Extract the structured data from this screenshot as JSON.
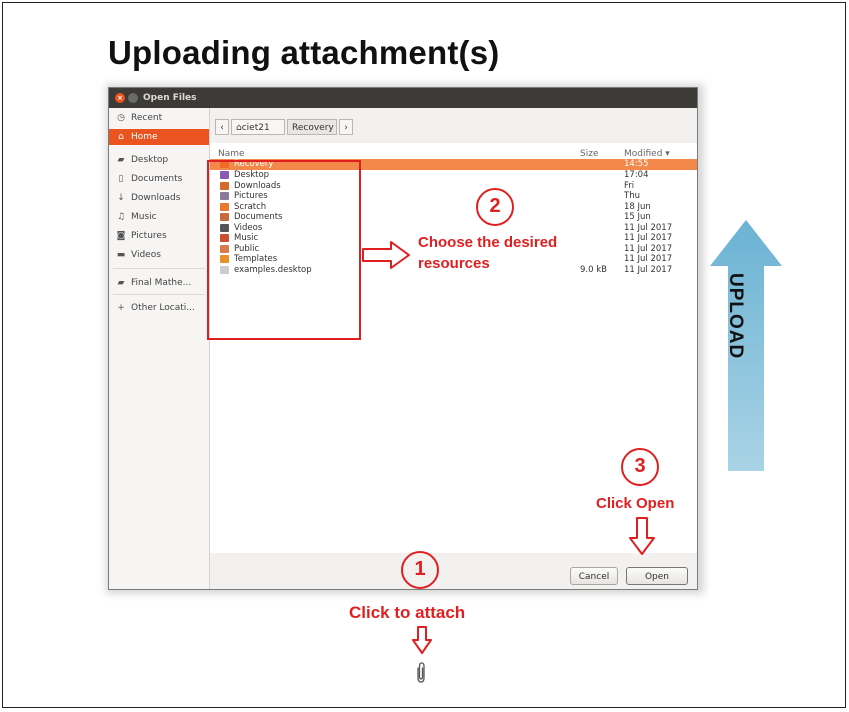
{
  "slide": {
    "title": "Uploading attachment(s)"
  },
  "dialog": {
    "window_title": "Open Files",
    "sidebar": [
      {
        "label": "Recent",
        "icon": "recent-icon"
      },
      {
        "label": "Home",
        "icon": "home-icon",
        "active": true
      },
      {
        "label": "Desktop",
        "icon": "desktop-folder-icon"
      },
      {
        "label": "Documents",
        "icon": "documents-icon"
      },
      {
        "label": "Downloads",
        "icon": "downloads-icon"
      },
      {
        "label": "Music",
        "icon": "music-icon"
      },
      {
        "label": "Pictures",
        "icon": "pictures-icon"
      },
      {
        "label": "Videos",
        "icon": "videos-icon"
      },
      {
        "label": "Final Mathe...",
        "icon": "drive-icon"
      },
      {
        "label": "Other Locati...",
        "icon": "plus-icon"
      }
    ],
    "breadcrumb": {
      "user": "ciet21",
      "current": "Recovery"
    },
    "columns": {
      "name": "Name",
      "size": "Size",
      "modified": "Modified"
    },
    "files": [
      {
        "name": "Recovery",
        "size": "",
        "modified": "14:55",
        "color": "#f06a2a"
      },
      {
        "name": "Desktop",
        "size": "",
        "modified": "17:04",
        "color": "#8a5ab0"
      },
      {
        "name": "Downloads",
        "size": "",
        "modified": "Fri",
        "color": "#d46a2a"
      },
      {
        "name": "Pictures",
        "size": "",
        "modified": "Thu",
        "color": "#8a7a9a"
      },
      {
        "name": "Scratch",
        "size": "",
        "modified": "18 Jun",
        "color": "#e8782a"
      },
      {
        "name": "Documents",
        "size": "",
        "modified": "15 Jun",
        "color": "#c86a3a"
      },
      {
        "name": "Videos",
        "size": "",
        "modified": "11 Jul 2017",
        "color": "#555555"
      },
      {
        "name": "Music",
        "size": "",
        "modified": "11 Jul 2017",
        "color": "#c8502a"
      },
      {
        "name": "Public",
        "size": "",
        "modified": "11 Jul 2017",
        "color": "#d87a4a"
      },
      {
        "name": "Templates",
        "size": "",
        "modified": "11 Jul 2017",
        "color": "#e8902a"
      },
      {
        "name": "examples.desktop",
        "size": "9.0 kB",
        "modified": "11 Jul 2017",
        "color": "#cccccc"
      }
    ],
    "buttons": {
      "cancel": "Cancel",
      "open": "Open"
    }
  },
  "annotations": {
    "step1_number": "1",
    "step1_text": "Click to attach",
    "step2_number": "2",
    "step2_text_line1": "Choose the desired",
    "step2_text_line2": "resources",
    "step3_number": "3",
    "step3_text": "Click Open",
    "upload_label": "UPLOAD"
  },
  "colors": {
    "accent": "#e95420",
    "annotation": "#e02020",
    "upload_arrow": "#8ec3dc"
  }
}
